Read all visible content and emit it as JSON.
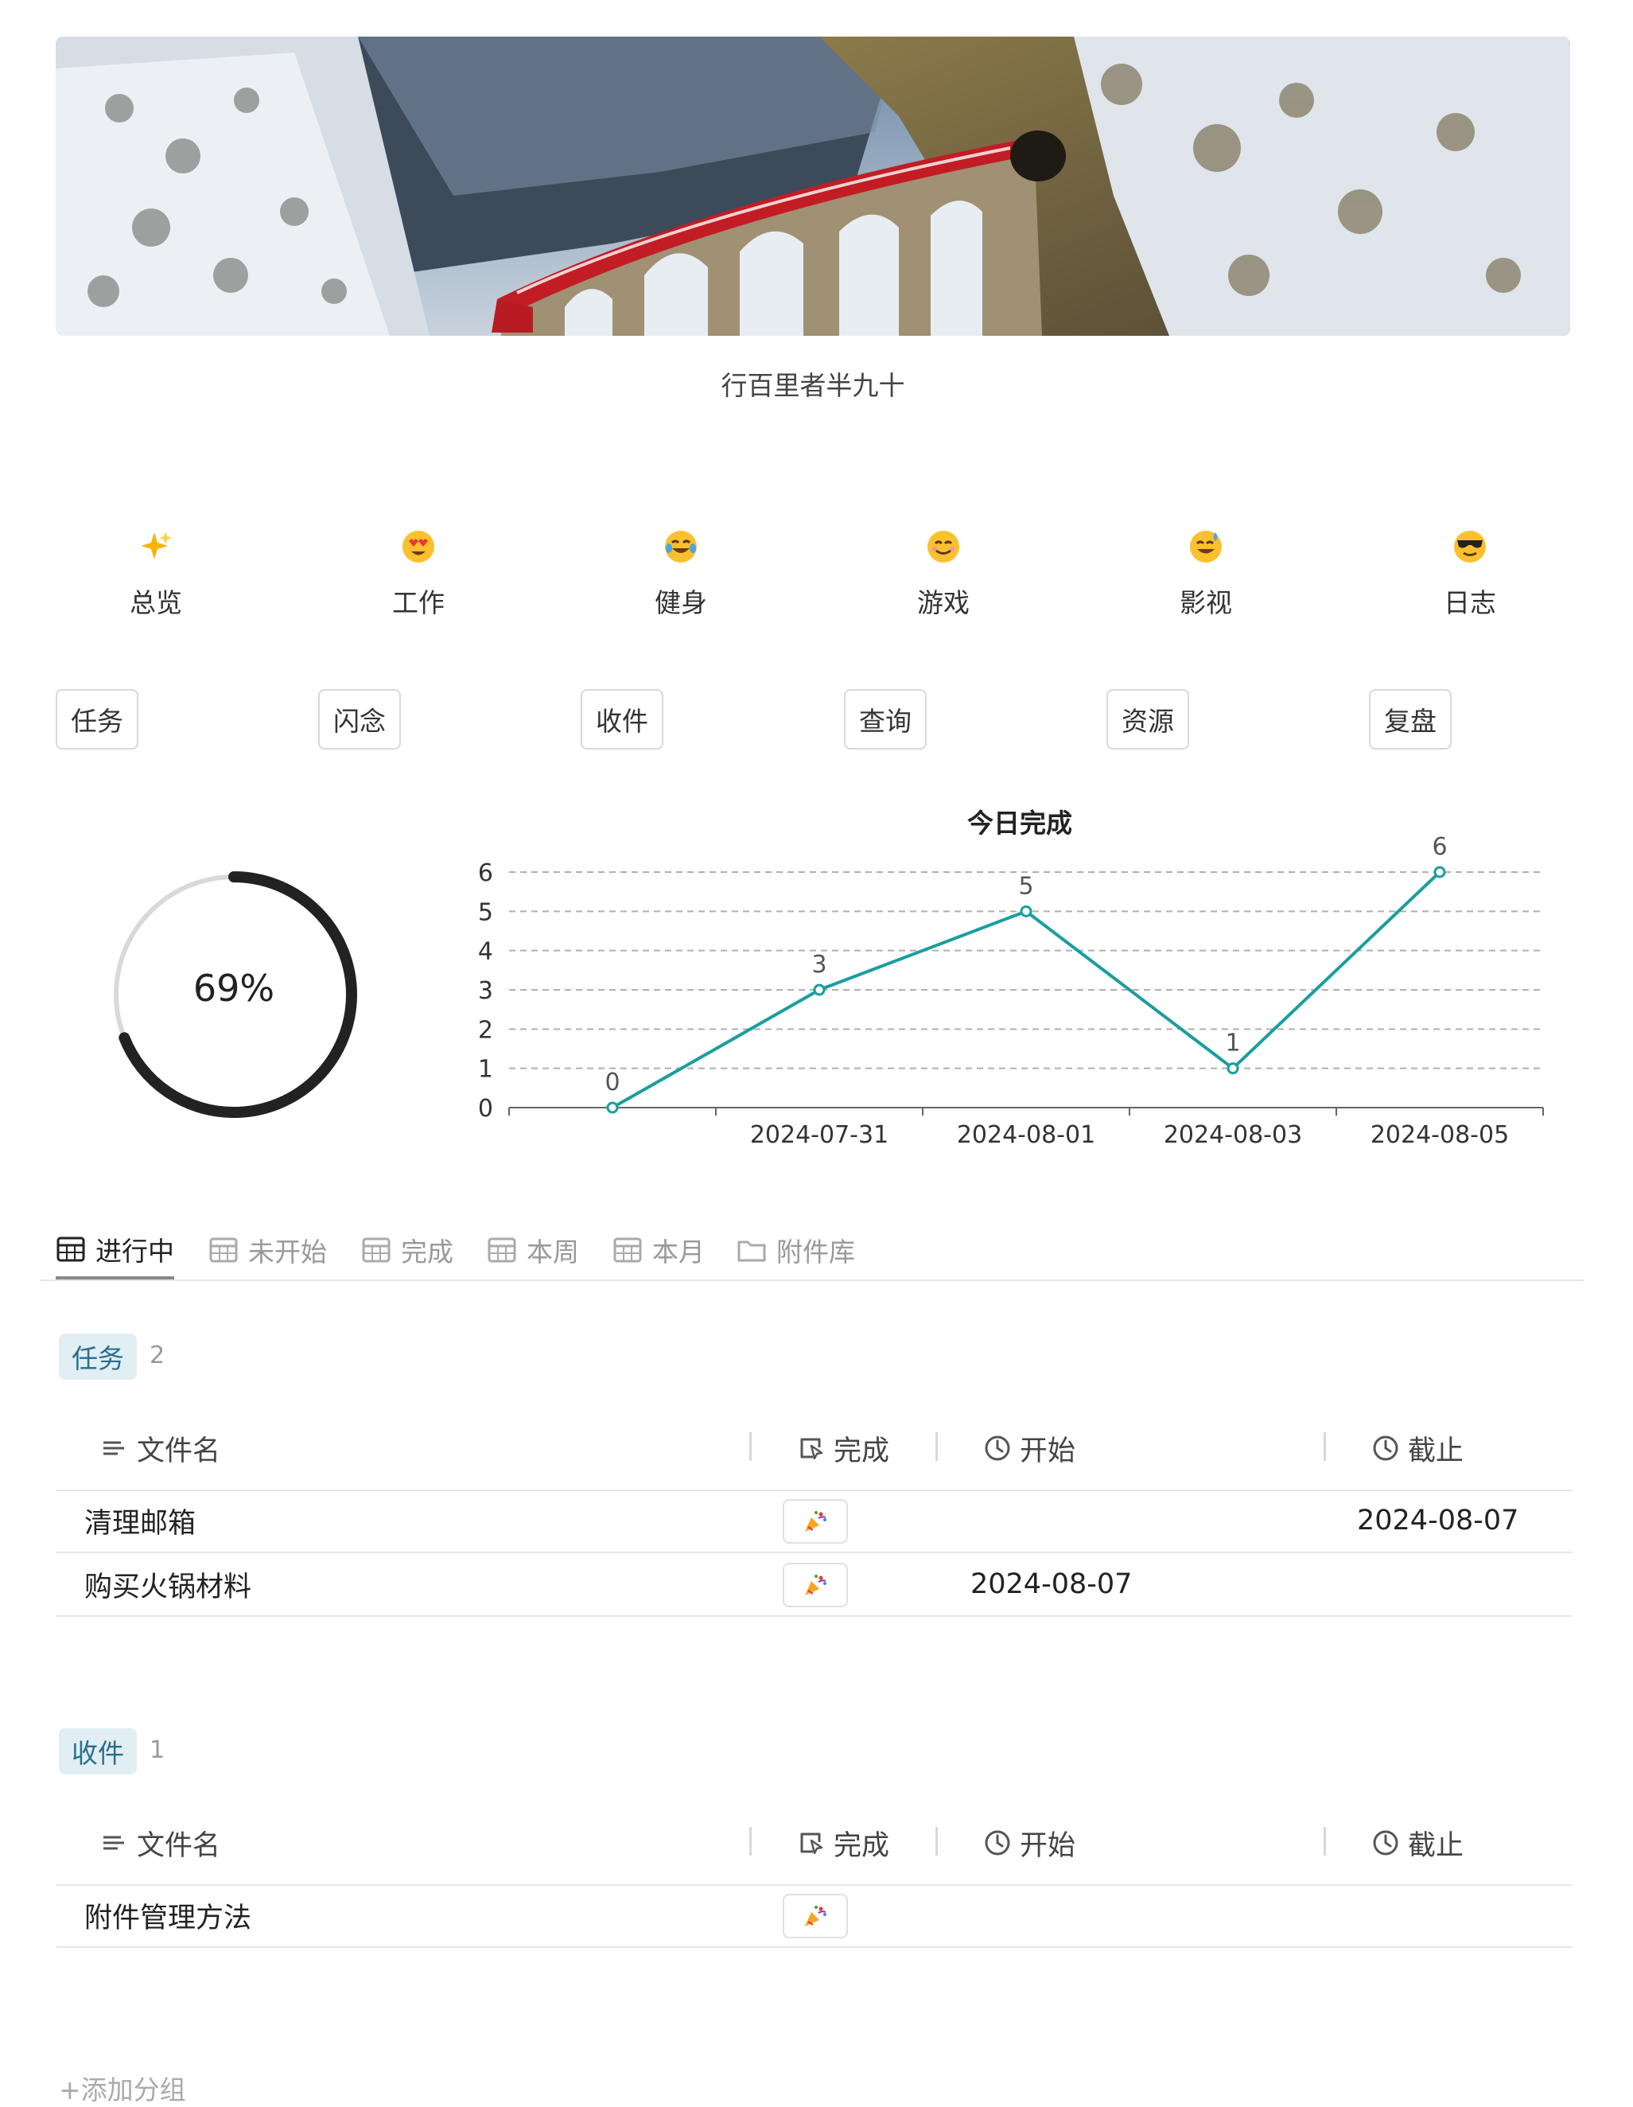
{
  "motto": "行百里者半九十",
  "categories": [
    {
      "emoji": "sparkles-icon",
      "label": "总览"
    },
    {
      "emoji": "heart-eyes-face-icon",
      "label": "工作"
    },
    {
      "emoji": "laughing-tears-face-icon",
      "label": "健身"
    },
    {
      "emoji": "smiling-face-icon",
      "label": "游戏"
    },
    {
      "emoji": "sweat-smile-face-icon",
      "label": "影视"
    },
    {
      "emoji": "sunglasses-face-icon",
      "label": "日志"
    }
  ],
  "buttons": [
    "任务",
    "闪念",
    "收件",
    "查询",
    "资源",
    "复盘"
  ],
  "progress": {
    "label": "69%",
    "value": 0.69
  },
  "chart_data": {
    "type": "line",
    "title": "今日完成",
    "categories": [
      "",
      "2024-07-31",
      "2024-08-01",
      "2024-08-03",
      "2024-08-05"
    ],
    "values": [
      0,
      3,
      5,
      1,
      6
    ],
    "ylim": [
      0,
      6
    ],
    "yticks": [
      0,
      1,
      2,
      3,
      4,
      5,
      6
    ],
    "grid": true,
    "color": "#1a9e9e"
  },
  "tabs": [
    {
      "label": "进行中",
      "icon": "table-icon",
      "active": true
    },
    {
      "label": "未开始",
      "icon": "table-icon",
      "active": false
    },
    {
      "label": "完成",
      "icon": "table-icon",
      "active": false
    },
    {
      "label": "本周",
      "icon": "table-icon",
      "active": false
    },
    {
      "label": "本月",
      "icon": "table-icon",
      "active": false
    },
    {
      "label": "附件库",
      "icon": "folder-icon",
      "active": false
    }
  ],
  "columns": {
    "name": "文件名",
    "done": "完成",
    "start": "开始",
    "due": "截止"
  },
  "groups": [
    {
      "tag": "任务",
      "count": "2",
      "rows": [
        {
          "name": "清理邮箱",
          "start": "",
          "due": "2024-08-07"
        },
        {
          "name": "购买火锅材料",
          "start": "2024-08-07",
          "due": ""
        }
      ]
    },
    {
      "tag": "收件",
      "count": "1",
      "rows": [
        {
          "name": "附件管理方法",
          "start": "",
          "due": ""
        }
      ]
    }
  ],
  "add_group": "+添加分组"
}
